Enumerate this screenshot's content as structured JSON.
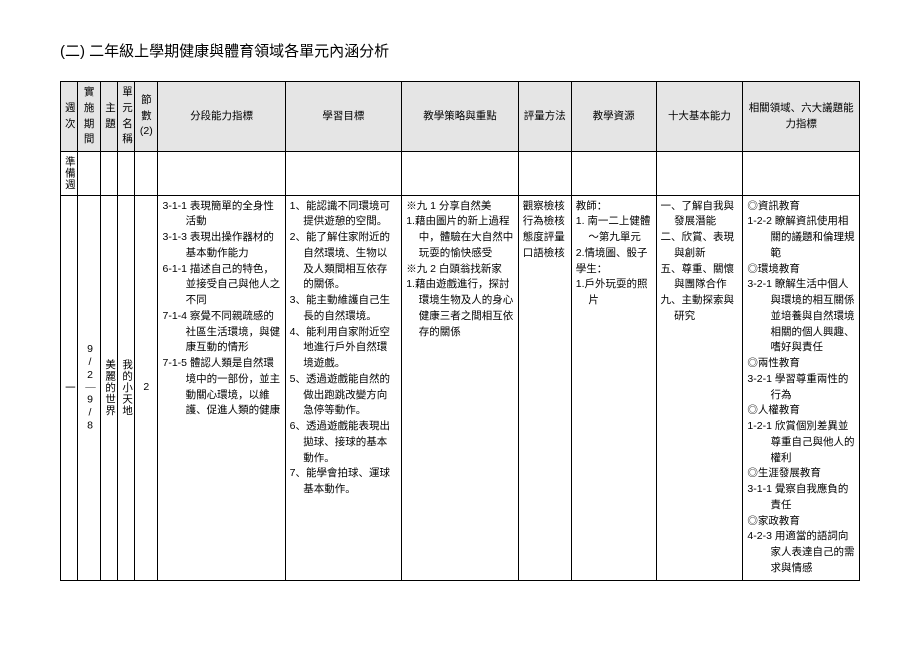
{
  "title": "(二) 二年級上學期健康與體育領域各單元內涵分析",
  "headers": {
    "week": "週次",
    "date": "實施期間",
    "theme": "主題",
    "unit": "單元名稱",
    "hours": "節數(2)",
    "indicator": "分段能力指標",
    "objective": "學習目標",
    "strategy": "教學策略與重點",
    "assess": "評量方法",
    "resource": "教學資源",
    "ability": "十大基本能力",
    "related": "相關領域、六大議題能力指標"
  },
  "prep": "準備週",
  "row": {
    "week": "一",
    "date": "9/2｜9/8",
    "theme": "美麗的世界",
    "unit": "我的小天地",
    "hours": "2",
    "indicators": [
      "3-1-1 表現簡單的全身性活動",
      "3-1-3 表現出操作器材的基本動作能力",
      "6-1-1 描述自己的特色，並接受自己與他人之不同",
      "7-1-4 察覺不同親疏感的社區生活環境，與健康互動的情形",
      "7-1-5 體認人類是自然環境中的一部份，並主動關心環境，以維護、促進人類的健康"
    ],
    "objectives": [
      "1、能認識不同環境可提供遊憩的空間。",
      "2、能了解住家附近的自然環境、生物以及人類間相互依存的關係。",
      "3、能主動維護自己生長的自然環境。",
      "4、能利用自家附近空地進行戶外自然環境遊戲。",
      "5、透過遊戲能自然的做出跑跳改變方向急停等動作。",
      "6、透過遊戲能表現出拋球、接球的基本動作。",
      "7、能學會拍球、運球基本動作。"
    ],
    "strategies": {
      "s1title": "※九 1 分享自然美",
      "s1items": [
        "1.藉由圖片的新上過程中，體驗在大自然中玩耍的愉快感受"
      ],
      "s2title": "※九 2 白頭翁找新家",
      "s2items": [
        "1.藉由遊戲進行，探討環境生物及人的身心健康三者之間相互依存的關係"
      ]
    },
    "assess": [
      "觀察檢核",
      "行為檢核",
      "態度評量",
      "口語檢核"
    ],
    "resource": {
      "tlabel": "教師：",
      "titems": [
        "1. 南一二上健體～第九單元",
        "2.情境圖、骰子"
      ],
      "slabel": "學生：",
      "sitems": [
        "1.戶外玩耍的照片"
      ]
    },
    "abilities": [
      "一、了解自我與發展潛能",
      "二、欣賞、表現與創新",
      "五、尊重、關懷與團隊合作",
      "九、主動探索與研究"
    ],
    "related": [
      {
        "cat": "◎資訊教育"
      },
      {
        "code": "1-2-2 瞭解資訊使用相關的議題和倫理規範"
      },
      {
        "cat": "◎環境教育"
      },
      {
        "code": "3-2-1 瞭解生活中個人與環境的相互關係並培養與自然環境相關的個人興趣、嗜好與責任"
      },
      {
        "cat": "◎兩性教育"
      },
      {
        "code": "3-2-1 學習尊重兩性的行為"
      },
      {
        "cat": "◎人權教育"
      },
      {
        "code": "1-2-1 欣賞個別差異並尊重自己與他人的權利"
      },
      {
        "cat": "◎生涯發展教育"
      },
      {
        "code": "3-1-1 覺察自我應負的責任"
      },
      {
        "cat": "◎家政教育"
      },
      {
        "code": "4-2-3 用適當的語詞向家人表達自己的需求與情感"
      }
    ]
  }
}
